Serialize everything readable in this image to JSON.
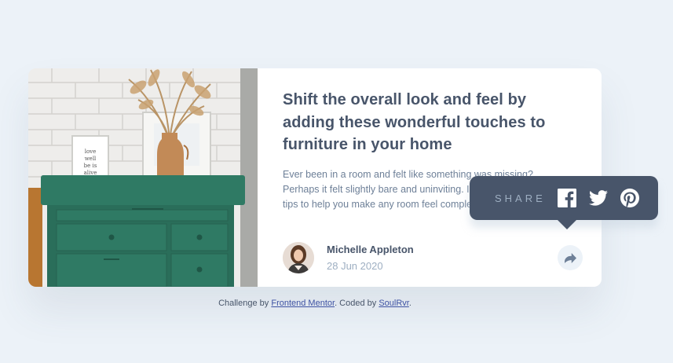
{
  "article": {
    "title": "Shift the overall look and feel by adding these wonderful touches to furniture in your home",
    "description": "Ever been in a room and felt like something was missing? Perhaps it felt slightly bare and uninviting. I’ve got some simple tips to help you make any room feel complete."
  },
  "author": {
    "name": "Michelle Appleton",
    "date": "28 Jun 2020"
  },
  "share": {
    "label": "SHARE",
    "icons": [
      "facebook-icon",
      "twitter-icon",
      "pinterest-icon"
    ]
  },
  "footer": {
    "prefix": "Challenge by ",
    "link1": "Frontend Mentor",
    "middle": ". Coded by ",
    "link2": "SoulRvr",
    "suffix": "."
  },
  "colors": {
    "background": "#ecf2f8",
    "dark_blue": "#48556a",
    "grayish_blue": "#6e8098",
    "light_grayish_blue": "#9eafc2",
    "dresser_green": "#2f7a64"
  }
}
